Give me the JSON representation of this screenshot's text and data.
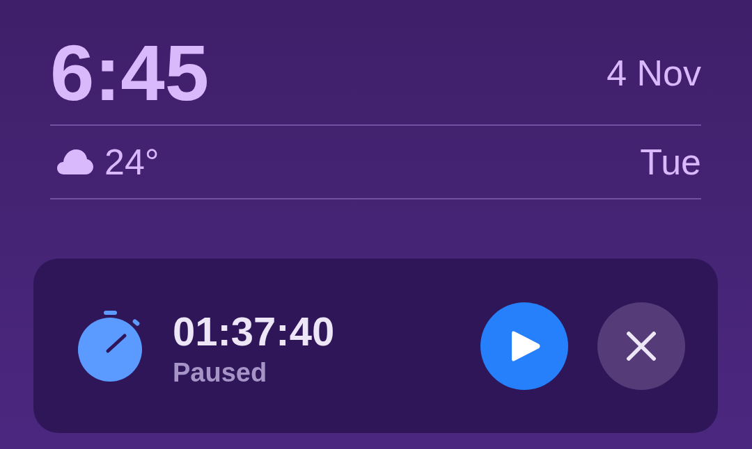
{
  "clock": {
    "time": "6:45",
    "date": "4 Nov"
  },
  "weather": {
    "temperature": "24°",
    "day": "Tue"
  },
  "timer": {
    "elapsed": "01:37:40",
    "status": "Paused",
    "paused": true
  }
}
